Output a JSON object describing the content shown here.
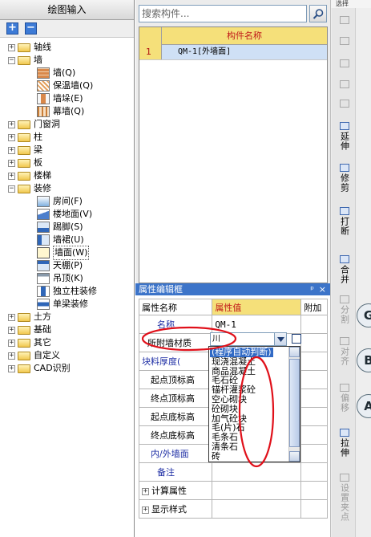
{
  "left_panel": {
    "title": "绘图输入",
    "add_symbol": "+",
    "remove_symbol": "−",
    "tree": [
      {
        "label": "轴线",
        "level": 0,
        "expander": "+",
        "icon": "folder-icon"
      },
      {
        "label": "墙",
        "level": 0,
        "expander": "−",
        "icon": "folder-open-icon"
      },
      {
        "label": "墙(Q)",
        "level": 1,
        "icon": "wall-icon"
      },
      {
        "label": "保温墙(Q)",
        "level": 1,
        "icon": "insulation-wall-icon"
      },
      {
        "label": "墙垛(E)",
        "level": 1,
        "icon": "wall-pier-icon"
      },
      {
        "label": "幕墙(Q)",
        "level": 1,
        "icon": "curtain-wall-icon"
      },
      {
        "label": "门窗洞",
        "level": 0,
        "expander": "+",
        "icon": "folder-icon"
      },
      {
        "label": "柱",
        "level": 0,
        "expander": "+",
        "icon": "folder-icon"
      },
      {
        "label": "梁",
        "level": 0,
        "expander": "+",
        "icon": "folder-icon"
      },
      {
        "label": "板",
        "level": 0,
        "expander": "+",
        "icon": "folder-icon"
      },
      {
        "label": "楼梯",
        "level": 0,
        "expander": "+",
        "icon": "folder-icon"
      },
      {
        "label": "装修",
        "level": 0,
        "expander": "−",
        "icon": "folder-open-icon"
      },
      {
        "label": "房间(F)",
        "level": 1,
        "icon": "room-icon"
      },
      {
        "label": "楼地面(V)",
        "level": 1,
        "icon": "floor-icon"
      },
      {
        "label": "踢脚(S)",
        "level": 1,
        "icon": "skirting-icon"
      },
      {
        "label": "墙裙(U)",
        "level": 1,
        "icon": "dado-icon"
      },
      {
        "label": "墙面(W)",
        "level": 1,
        "icon": "wall-finish-icon",
        "selected": true
      },
      {
        "label": "天棚(P)",
        "level": 1,
        "icon": "ceiling-icon"
      },
      {
        "label": "吊顶(K)",
        "level": 1,
        "icon": "suspended-ceiling-icon"
      },
      {
        "label": "独立柱装修",
        "level": 1,
        "icon": "column-finish-icon"
      },
      {
        "label": "单梁装修",
        "level": 1,
        "icon": "beam-finish-icon"
      },
      {
        "label": "土方",
        "level": 0,
        "expander": "+",
        "icon": "folder-icon"
      },
      {
        "label": "基础",
        "level": 0,
        "expander": "+",
        "icon": "folder-icon"
      },
      {
        "label": "其它",
        "level": 0,
        "expander": "+",
        "icon": "folder-icon"
      },
      {
        "label": "自定义",
        "level": 0,
        "expander": "+",
        "icon": "folder-icon"
      },
      {
        "label": "CAD识别",
        "level": 0,
        "expander": "+",
        "icon": "folder-icon"
      }
    ]
  },
  "search": {
    "placeholder": "搜索构件..."
  },
  "component_grid": {
    "header": "构件名称",
    "rows": [
      {
        "index": "1",
        "name": "QM-1[外墙面]"
      }
    ]
  },
  "property_editor": {
    "title": "属性编辑框",
    "pin_symbol": "ᵖ",
    "close_symbol": "×",
    "headers": {
      "name": "属性名称",
      "value": "属性值",
      "extra": "附加"
    },
    "rows": [
      {
        "name": "名称",
        "value": "QM-1",
        "blue": true
      },
      {
        "name": "所附墙材质",
        "value": "",
        "blue": false
      },
      {
        "name": "块料厚度(",
        "value": "",
        "blue": true
      },
      {
        "name": "起点顶标高",
        "value": "",
        "blue": false
      },
      {
        "name": "终点顶标高",
        "value": "",
        "blue": false
      },
      {
        "name": "起点底标高",
        "value": "",
        "blue": false
      },
      {
        "name": "终点底标高",
        "value": "",
        "blue": false
      },
      {
        "name": "内/外墙面",
        "value": "",
        "blue": true
      },
      {
        "name": "备注",
        "value": "",
        "blue": true
      }
    ],
    "groups": [
      {
        "expander": "+",
        "label": "计算属性"
      },
      {
        "expander": "+",
        "label": "显示样式"
      }
    ],
    "material_combo_value": "川"
  },
  "material_dropdown": {
    "options": [
      "(程序自动判断)",
      "现浇混凝土",
      "商品混凝土",
      "毛石砼",
      "锚杆灌浆砼",
      "空心砌块",
      "砼砌块",
      "加气砼块",
      "毛(片)石",
      "毛条石",
      "清条石",
      "砖"
    ],
    "highlighted_index": 0
  },
  "right_toolbar": {
    "top_label": "选择",
    "tools": [
      {
        "label": "",
        "icon": "pencil-icon",
        "enabled": false
      },
      {
        "label": "",
        "icon": "copy-icon",
        "enabled": false
      },
      {
        "label": "",
        "icon": "mirror-icon",
        "enabled": false
      },
      {
        "label": "",
        "icon": "move-icon",
        "enabled": false
      },
      {
        "label": "",
        "icon": "rotate-icon",
        "enabled": false
      },
      {
        "label": "延伸",
        "icon": "extend-icon",
        "enabled": true
      },
      {
        "label": "修剪",
        "icon": "trim-icon",
        "enabled": true
      },
      {
        "label": "打断",
        "icon": "break-icon",
        "enabled": true
      },
      {
        "label": "合并",
        "icon": "merge-icon",
        "enabled": true
      },
      {
        "label": "分割",
        "icon": "split-icon",
        "enabled": false
      },
      {
        "label": "对齐",
        "icon": "align-icon",
        "enabled": false
      },
      {
        "label": "偏移",
        "icon": "offset-icon",
        "enabled": false
      },
      {
        "label": "拉伸",
        "icon": "stretch-icon",
        "enabled": true
      },
      {
        "label": "设置夹点",
        "icon": "grip-icon",
        "enabled": false
      }
    ],
    "axis_markers": [
      "G",
      "B",
      "A"
    ]
  },
  "colors": {
    "header_yellow": "#f5e07a",
    "header_red_text": "#c11a1a",
    "selection_blue": "#316ac5",
    "panel_title_blue": "#3c74c9",
    "annotation_red": "#e0101a"
  }
}
